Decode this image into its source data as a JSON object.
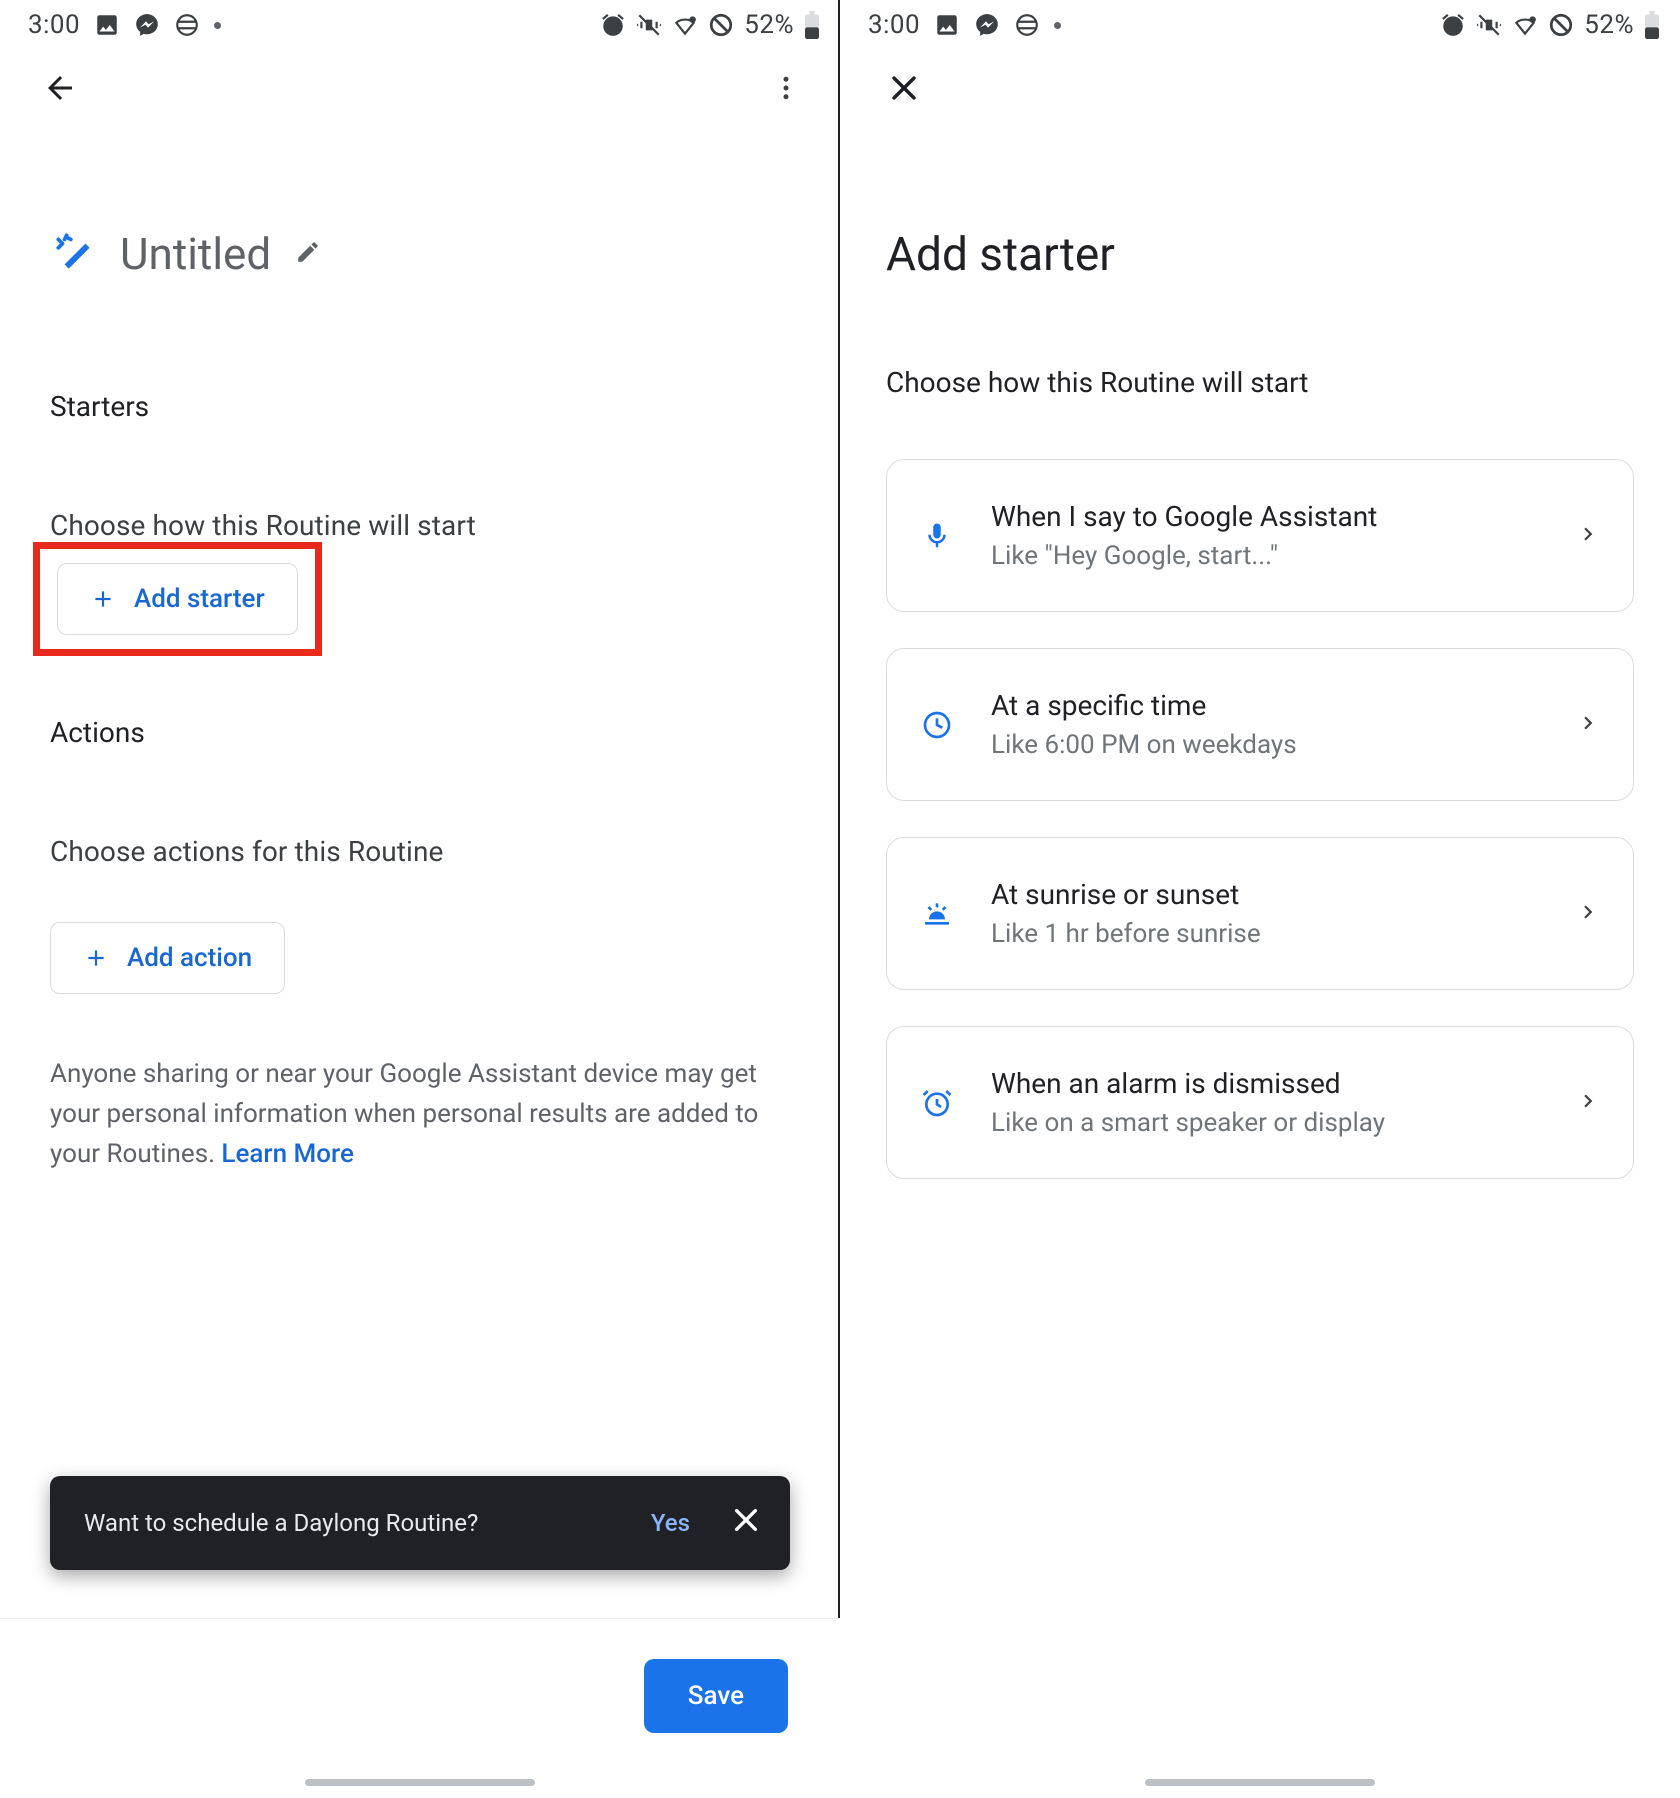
{
  "status": {
    "time": "3:00",
    "battery_pct": "52%"
  },
  "left": {
    "title": "Untitled",
    "starters_h": "Starters",
    "starters_sub": "Choose how this Routine will start",
    "add_starter": "Add starter",
    "actions_h": "Actions",
    "actions_sub": "Choose actions for this Routine",
    "add_action": "Add action",
    "disclaimer": "Anyone sharing or near your Google Assistant device may get your personal information when personal results are added to your Routines. ",
    "learn_more": "Learn More",
    "snackbar_text": "Want to schedule a Daylong Routine?",
    "snackbar_yes": "Yes",
    "save": "Save"
  },
  "right": {
    "title": "Add starter",
    "sub": "Choose how this Routine will start",
    "cards": [
      {
        "title": "When I say to Google Assistant",
        "sub": "Like \"Hey Google, start...\""
      },
      {
        "title": "At a specific time",
        "sub": "Like 6:00 PM on weekdays"
      },
      {
        "title": "At sunrise or sunset",
        "sub": "Like 1 hr before sunrise"
      },
      {
        "title": "When an alarm is dismissed",
        "sub": "Like on a smart speaker or display"
      }
    ]
  }
}
